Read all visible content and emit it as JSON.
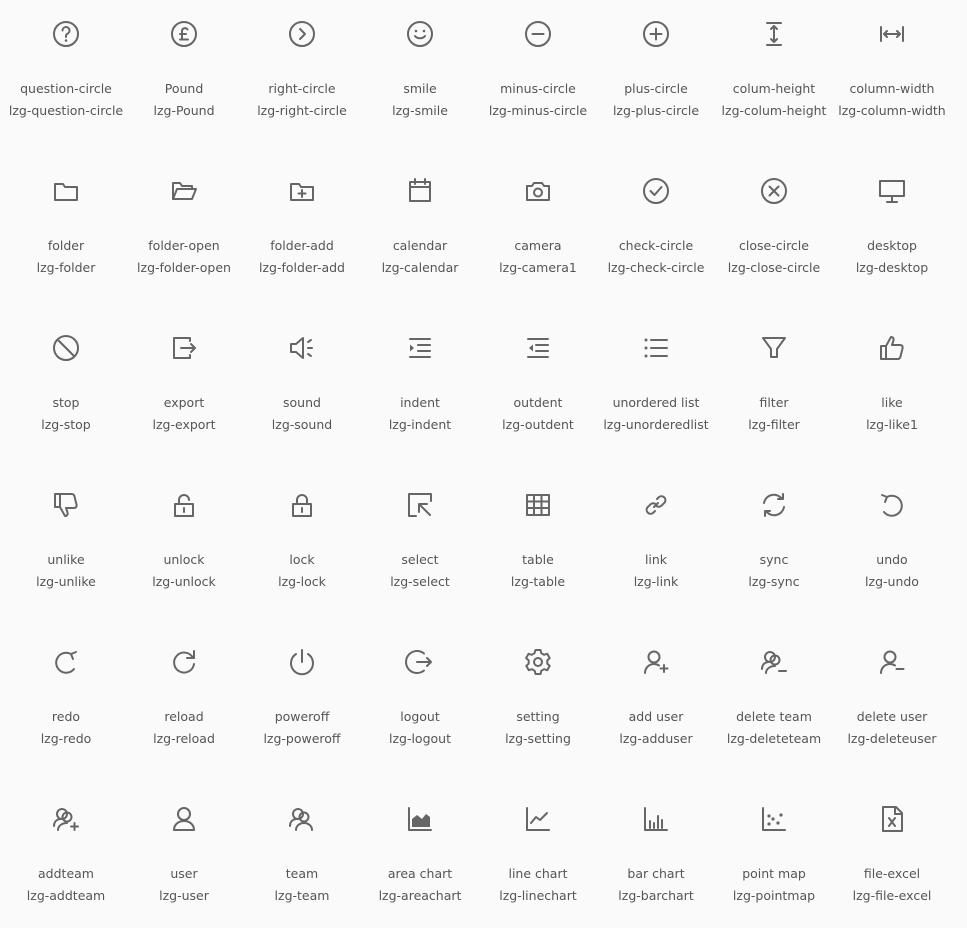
{
  "accent_color": "#666666",
  "icons": [
    {
      "label": "question-circle",
      "class": "lzg-question-circle",
      "icon": "question-circle-icon"
    },
    {
      "label": "Pound",
      "class": "lzg-Pound",
      "icon": "pound-icon"
    },
    {
      "label": "right-circle",
      "class": "lzg-right-circle",
      "icon": "right-circle-icon"
    },
    {
      "label": "smile",
      "class": "lzg-smile",
      "icon": "smile-icon"
    },
    {
      "label": "minus-circle",
      "class": "lzg-minus-circle",
      "icon": "minus-circle-icon"
    },
    {
      "label": "plus-circle",
      "class": "lzg-plus-circle",
      "icon": "plus-circle-icon"
    },
    {
      "label": "colum-height",
      "class": "lzg-colum-height",
      "icon": "column-height-icon"
    },
    {
      "label": "column-width",
      "class": "lzg-column-width",
      "icon": "column-width-icon"
    },
    {
      "label": "folder",
      "class": "lzg-folder",
      "icon": "folder-icon"
    },
    {
      "label": "folder-open",
      "class": "lzg-folder-open",
      "icon": "folder-open-icon"
    },
    {
      "label": "folder-add",
      "class": "lzg-folder-add",
      "icon": "folder-add-icon"
    },
    {
      "label": "calendar",
      "class": "lzg-calendar",
      "icon": "calendar-icon"
    },
    {
      "label": "camera",
      "class": "lzg-camera1",
      "icon": "camera-icon"
    },
    {
      "label": "check-circle",
      "class": "lzg-check-circle",
      "icon": "check-circle-icon"
    },
    {
      "label": "close-circle",
      "class": "lzg-close-circle",
      "icon": "close-circle-icon"
    },
    {
      "label": "desktop",
      "class": "lzg-desktop",
      "icon": "desktop-icon"
    },
    {
      "label": "stop",
      "class": "lzg-stop",
      "icon": "stop-icon"
    },
    {
      "label": "export",
      "class": "lzg-export",
      "icon": "export-icon"
    },
    {
      "label": "sound",
      "class": "lzg-sound",
      "icon": "sound-icon"
    },
    {
      "label": "indent",
      "class": "lzg-indent",
      "icon": "indent-icon"
    },
    {
      "label": "outdent",
      "class": "lzg-outdent",
      "icon": "outdent-icon"
    },
    {
      "label": "unordered list",
      "class": "lzg-unorderedlist",
      "icon": "unordered-list-icon"
    },
    {
      "label": "filter",
      "class": "lzg-filter",
      "icon": "filter-icon"
    },
    {
      "label": "like",
      "class": "lzg-like1",
      "icon": "like-icon"
    },
    {
      "label": "unlike",
      "class": "lzg-unlike",
      "icon": "unlike-icon"
    },
    {
      "label": "unlock",
      "class": "lzg-unlock",
      "icon": "unlock-icon"
    },
    {
      "label": "lock",
      "class": "lzg-lock",
      "icon": "lock-icon"
    },
    {
      "label": "select",
      "class": "lzg-select",
      "icon": "select-icon"
    },
    {
      "label": "table",
      "class": "lzg-table",
      "icon": "table-icon"
    },
    {
      "label": "link",
      "class": "lzg-link",
      "icon": "link-icon"
    },
    {
      "label": "sync",
      "class": "lzg-sync",
      "icon": "sync-icon"
    },
    {
      "label": "undo",
      "class": "lzg-undo",
      "icon": "undo-icon"
    },
    {
      "label": "redo",
      "class": "lzg-redo",
      "icon": "redo-icon"
    },
    {
      "label": "reload",
      "class": "lzg-reload",
      "icon": "reload-icon"
    },
    {
      "label": "poweroff",
      "class": "lzg-poweroff",
      "icon": "poweroff-icon"
    },
    {
      "label": "logout",
      "class": "lzg-logout",
      "icon": "logout-icon"
    },
    {
      "label": "setting",
      "class": "lzg-setting",
      "icon": "setting-icon"
    },
    {
      "label": "add user",
      "class": "lzg-adduser",
      "icon": "add-user-icon"
    },
    {
      "label": "delete team",
      "class": "lzg-deleteteam",
      "icon": "delete-team-icon"
    },
    {
      "label": "delete user",
      "class": "lzg-deleteuser",
      "icon": "delete-user-icon"
    },
    {
      "label": "addteam",
      "class": "lzg-addteam",
      "icon": "add-team-icon"
    },
    {
      "label": "user",
      "class": "lzg-user",
      "icon": "user-icon"
    },
    {
      "label": "team",
      "class": "lzg-team",
      "icon": "team-icon"
    },
    {
      "label": "area chart",
      "class": "lzg-areachart",
      "icon": "area-chart-icon"
    },
    {
      "label": "line chart",
      "class": "lzg-linechart",
      "icon": "line-chart-icon"
    },
    {
      "label": "bar chart",
      "class": "lzg-barchart",
      "icon": "bar-chart-icon"
    },
    {
      "label": "point map",
      "class": "lzg-pointmap",
      "icon": "point-map-icon"
    },
    {
      "label": "file-excel",
      "class": "lzg-file-excel",
      "icon": "file-excel-icon"
    }
  ]
}
